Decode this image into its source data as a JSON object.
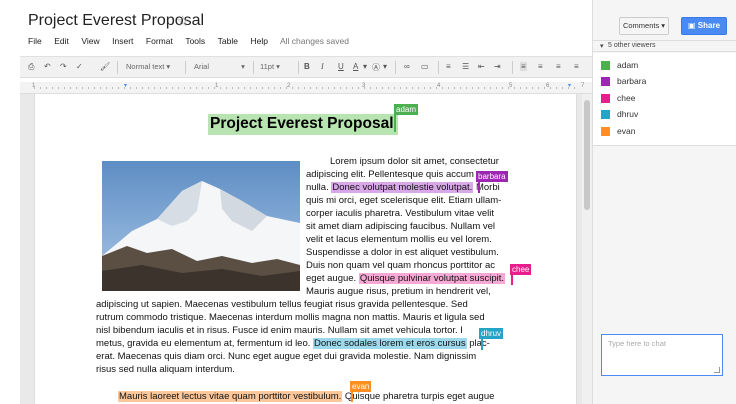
{
  "document": {
    "title": "Project Everest Proposal",
    "save_status": "All changes saved"
  },
  "menu": [
    "File",
    "Edit",
    "View",
    "Insert",
    "Format",
    "Tools",
    "Table",
    "Help"
  ],
  "toolbar": {
    "style_select": "Normal text",
    "font_select": "Arial",
    "size_select": "11pt",
    "bold": "B",
    "italic": "I",
    "underline": "U",
    "text_color": "A"
  },
  "ruler": {
    "numbers": [
      "1",
      "1",
      "2",
      "3",
      "4",
      "5",
      "6",
      "7"
    ]
  },
  "body": {
    "heading": "Project Everest Proposal",
    "lines": {
      "l1": "Lorem ipsum dolor sit amet, consectetur",
      "l2a": "adipiscing elit. Pellentesque quis accum",
      "l3a": "nulla. ",
      "l3b": "Donec volutpat molestie volutpat.",
      "l3c": " Morbi",
      "l4": "quis mi orci, eget scelerisque elit. Etiam ullam-",
      "l5": "corper iaculis pharetra. Vestibulum vitae velit",
      "l6": "sit amet diam adipiscing faucibus. Nullam vel",
      "l7": "velit et lacus elementum mollis eu vel lorem.",
      "l8": "Suspendisse a dolor in est aliquet vestibulum.",
      "l9": "Duis non quam vel quam rhoncus porttitor ac",
      "l10a": "eget augue. ",
      "l10b": "Quisque pulvinar volutpat suscipit.",
      "l11": "Mauris augue risus, pretium in hendrerit vel,",
      "l12": "adipiscing ut sapien. Maecenas vestibulum tellus feugiat risus gravida pellentesque. Sed",
      "l13": "rutrum commodo tristique. Maecenas interdum mollis magna non mattis. Mauris et ligula sed",
      "l14a": "nisl bibendum iaculis et in risus. Fusce id enim mauris. Nullam sit amet vehicula tortor. I",
      "l14b": "o",
      "l15a": "metus, gravida eu elementum at, fermentum id leo. ",
      "l15b": "Donec sodales lorem et eros cursus",
      "l15c": " plac-",
      "l16": "erat. Maecenas quis diam orci. Nunc eget augue eget dui gravida molestie. Nam dignissim",
      "l17": "risus sed nulla aliquam interdum.",
      "l18a": "Mauris laoreet lectus vitae quam porttitor vestibulum.",
      "l18b": " Quisque pharetra turpis eget augue"
    }
  },
  "collaborators": [
    {
      "name": "adam",
      "color": "#4caf50"
    },
    {
      "name": "barbara",
      "color": "#9c27b0"
    },
    {
      "name": "chee",
      "color": "#e91e8c"
    },
    {
      "name": "dhruv",
      "color": "#26a3c8"
    },
    {
      "name": "evan",
      "color": "#ff8f1f"
    }
  ],
  "highlights": {
    "adam": "#b7e4b0",
    "barbara": "#d9a8e8",
    "chee": "#f7a8d4",
    "dhruv": "#9dd9ec",
    "evan": "#fcc79a"
  },
  "sidebar": {
    "comments_label": "Comments",
    "share_label": "Share",
    "viewers_label": "5 other viewers",
    "chat_placeholder": "Type here to chat"
  }
}
